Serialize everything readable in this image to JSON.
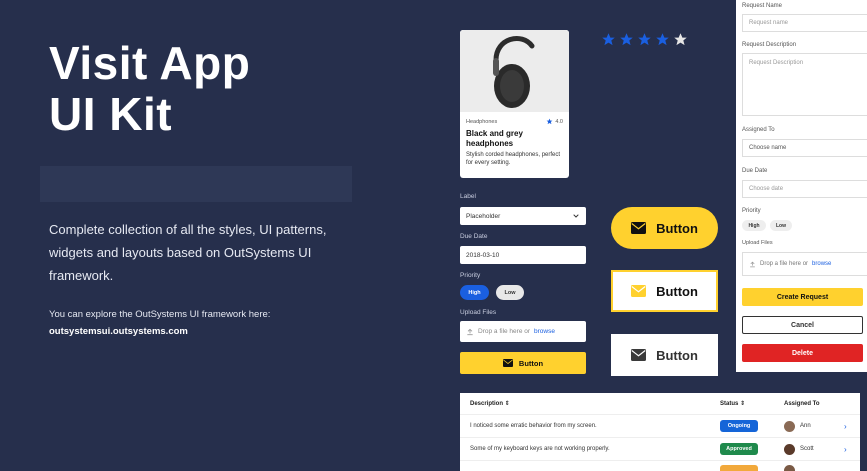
{
  "hero": {
    "title_line1": "Visit App",
    "title_line2": "UI Kit",
    "description": "Complete collection of all the styles, UI patterns, widgets and layouts based on OutSystems UI framework.",
    "explore_text": "You can explore the OutSystems UI framework here:",
    "url": "outsystemsui.outsystems.com"
  },
  "product_card": {
    "category": "Headphones",
    "rating": "4.0",
    "title": "Black and grey headphones",
    "description": "Stylish corded headphones, perfect for every setting."
  },
  "rating_stars": {
    "filled": 4,
    "total": 5,
    "filled_color": "#1a5fe0",
    "empty_color": "#e6e6e6"
  },
  "left_form": {
    "label_label": "Label",
    "select_value": "Placeholder",
    "due_date_label": "Due Date",
    "due_date_value": "2018-03-10",
    "priority_label": "Priority",
    "priority_high": "High",
    "priority_low": "Low",
    "upload_label": "Upload Files",
    "upload_text": "Drop a file here or",
    "upload_link": "browse",
    "button_label": "Button"
  },
  "buttons": {
    "pill": "Button",
    "outline_yellow": "Button",
    "outline_grey": "Button"
  },
  "request_panel": {
    "name_label": "Request Name",
    "name_placeholder": "Request name",
    "desc_label": "Request Description",
    "desc_placeholder": "Request Description",
    "assigned_label": "Assigned To",
    "assigned_placeholder": "Choose name",
    "due_label": "Due Date",
    "due_placeholder": "Choose date",
    "priority_label": "Priority",
    "priority_high": "High",
    "priority_low": "Low",
    "upload_label": "Upload Files",
    "upload_text": "Drop a file here or",
    "upload_link": "browse",
    "create_label": "Create Request",
    "cancel_label": "Cancel",
    "delete_label": "Delete"
  },
  "table": {
    "headers": {
      "description": "Description",
      "status": "Status",
      "assigned": "Assigned To"
    },
    "rows": [
      {
        "description": "I noticed some erratic behavior from my screen.",
        "status": "Ongoing",
        "status_color": "#1565d8",
        "assignee": "Ann"
      },
      {
        "description": "Some of my keyboard keys are not working properly.",
        "status": "Approved",
        "status_color": "#1f8a4c",
        "assignee": "Scott"
      },
      {
        "description": "",
        "status": "",
        "status_color": "#f2a93b",
        "assignee": ""
      }
    ]
  },
  "colors": {
    "background": "#262f4c",
    "accent_yellow": "#ffd12e",
    "accent_blue": "#1a5fe0",
    "danger": "#e02424"
  }
}
